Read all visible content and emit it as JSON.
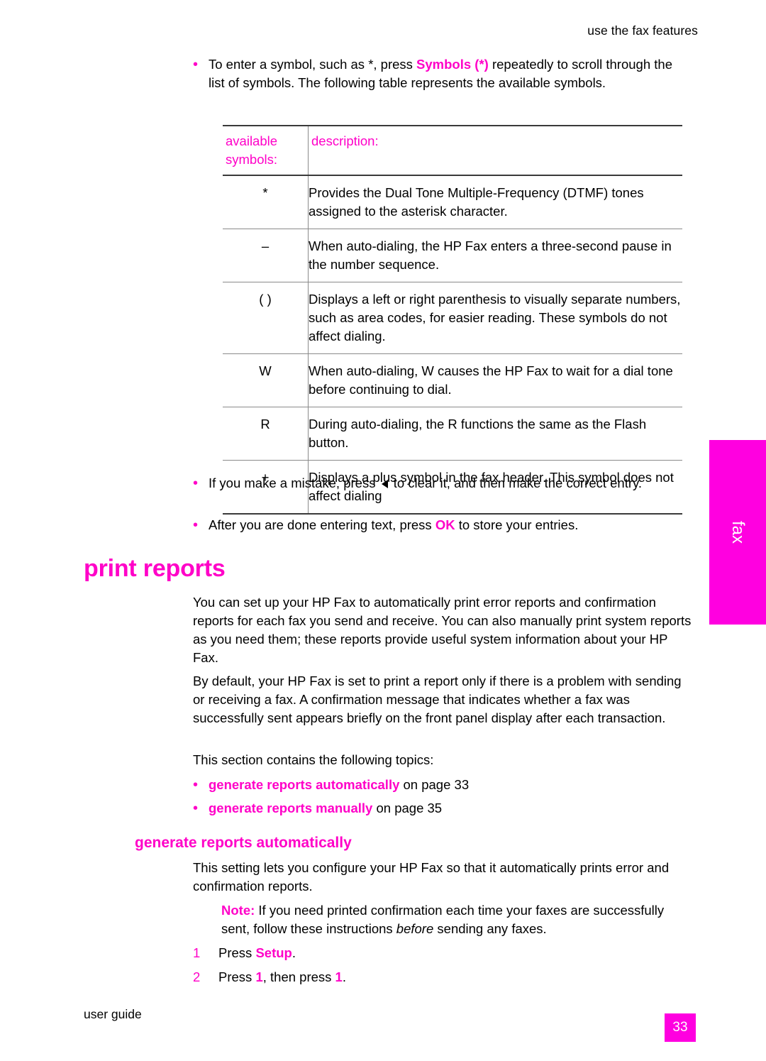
{
  "header": {
    "running_head": "use the fax features"
  },
  "side_tab": {
    "label": "fax"
  },
  "intro_bullet": {
    "part1": "To enter a symbol, such as *, press ",
    "symbols_label": "Symbols",
    "star_label": "(*)",
    "part2": " repeatedly to scroll through the list of symbols. The following table represents the available symbols."
  },
  "table": {
    "headers": [
      "available symbols:",
      "description:"
    ],
    "header_sym_line1": "available",
    "header_sym_line2": "symbols:",
    "header_desc": "description:",
    "rows": [
      {
        "symbol": "*",
        "description": "Provides the Dual Tone Multiple-Frequency (DTMF) tones assigned to the asterisk character."
      },
      {
        "symbol": "–",
        "description": "When auto-dialing, the HP Fax enters a three-second pause in the number sequence."
      },
      {
        "symbol": "( )",
        "description": "Displays a left or right parenthesis to visually separate numbers, such as area codes, for easier reading. These symbols do not affect dialing."
      },
      {
        "symbol": "W",
        "description": "When auto-dialing, W causes the HP Fax to wait for a dial tone before continuing to dial."
      },
      {
        "symbol": "R",
        "description": "During auto-dialing, the R functions the same as the Flash button."
      },
      {
        "symbol": "+",
        "description": "Displays a plus symbol in the fax header. This symbol does not affect dialing"
      }
    ]
  },
  "bullets_after_table": [
    {
      "part1": "If you make a mistake, press ",
      "icon": "left-arrow-icon",
      "part2": " to clear it, and then make the correct entry."
    },
    {
      "part1": "After you are done entering text, press ",
      "key": "OK",
      "part2": " to store your entries."
    }
  ],
  "print_reports": {
    "heading": "print reports",
    "para1": "You can set up your HP Fax to automatically print error reports and confirmation reports for each fax you send and receive. You can also manually print system reports as you need them; these reports provide useful system information about your HP Fax.",
    "para2": "By default, your HP Fax is set to print a report only if there is a problem with sending or receiving a fax. A confirmation message that indicates whether a fax was successfully sent appears briefly on the front panel display after each transaction.",
    "para3": "This section contains the following topics:",
    "topics": [
      {
        "link": "generate reports automatically",
        "suffix": " on page 33"
      },
      {
        "link": "generate reports manually",
        "suffix": " on page 35"
      }
    ]
  },
  "generate_auto": {
    "heading": "generate reports automatically",
    "para1": "This setting lets you configure your HP Fax so that it automatically prints error and confirmation reports.",
    "note_label": "Note:",
    "note_text_part1": " If you need printed confirmation each time your faxes are successfully sent, follow these instructions ",
    "note_text_italic": "before",
    "note_text_part2": " sending any faxes.",
    "steps": [
      {
        "num": "1",
        "pre": "Press ",
        "key": "Setup",
        "post": "."
      },
      {
        "num": "2",
        "pre": "Press ",
        "key": "1",
        "mid": ", then press ",
        "key2": "1",
        "post": "."
      }
    ]
  },
  "footer": {
    "left": "user guide",
    "page_number": "33"
  }
}
